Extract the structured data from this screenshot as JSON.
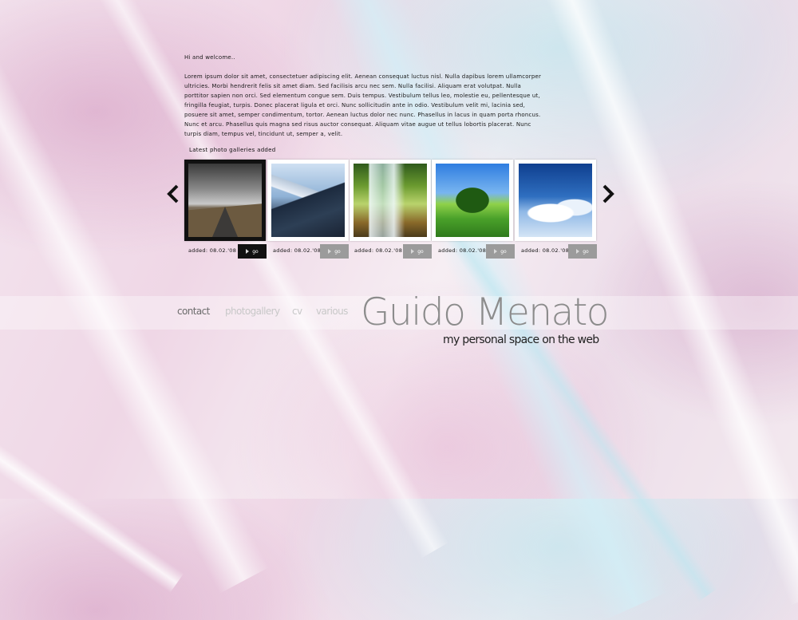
{
  "intro": {
    "greeting": "Hi and welcome..",
    "body": "Lorem ipsum dolor sit amet, consectetuer adipiscing elit. Aenean consequat luctus nisl. Nulla dapibus lorem ullamcorper ultricies. Morbi hendrerit felis sit amet diam. Sed facilisis arcu nec sem. Nulla facilisi. Aliquam erat volutpat. Nulla porttitor sapien non orci. Sed elementum congue sem. Duis tempus. Vestibulum tellus leo, molestie eu, pellentesque ut, fringilla feugiat, turpis. Donec placerat ligula et orci. Nunc sollicitudin ante in odio. Vestibulum velit mi, lacinia sed, posuere sit amet, semper condimentum, tortor. Aenean luctus dolor nec nunc. Phasellus in lacus in quam porta rhoncus. Nunc et arcu. Phasellus quis magna sed risus auctor consequat. Aliquam vitae augue ut tellus lobortis placerat. Nunc turpis diam, tempus vel, tincidunt ut, semper a, velit."
  },
  "gallery": {
    "title": "Latest photo galleries added",
    "items": [
      {
        "photo": "road",
        "added": "added: 08.02.'08",
        "go": "go"
      },
      {
        "photo": "mountains",
        "added": "added: 08.02.'08",
        "go": "go"
      },
      {
        "photo": "waterfall",
        "added": "added: 08.02.'08",
        "go": "go"
      },
      {
        "photo": "tree",
        "added": "added: 08.02.'08",
        "go": "go"
      },
      {
        "photo": "clouds",
        "added": "added: 08.02.'08",
        "go": "go"
      }
    ]
  },
  "nav": {
    "contact": "contact",
    "photogallery": "photogallery",
    "cv": "cv",
    "various": "various"
  },
  "brand": {
    "name": "Guido Menato",
    "tagline": "my personal space on the web"
  }
}
